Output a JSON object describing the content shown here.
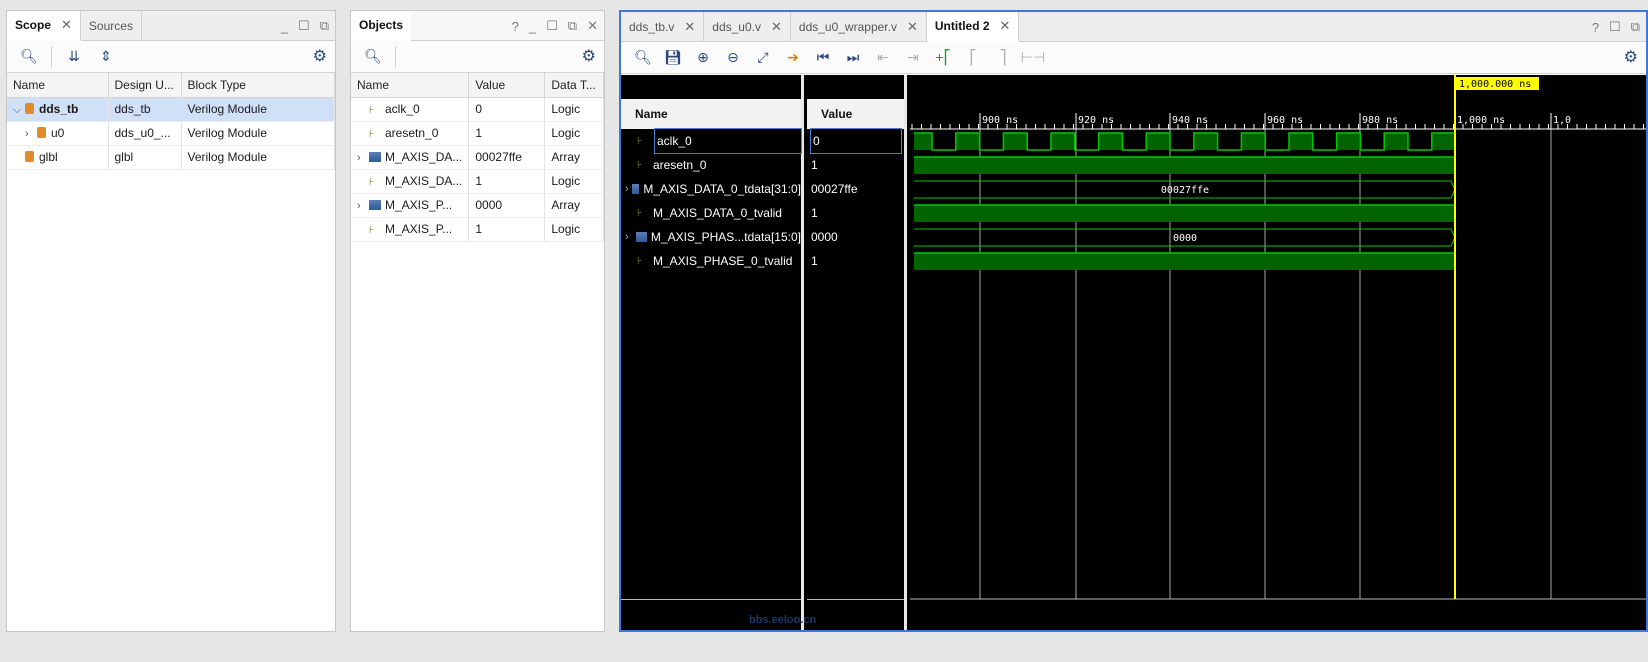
{
  "scope_panel": {
    "tabs": [
      {
        "label": "Scope"
      },
      {
        "label": "Sources"
      }
    ],
    "columns": [
      "Name",
      "Design U...",
      "Block Type"
    ],
    "rows": [
      {
        "name": "dds_tb",
        "design_unit": "dds_tb",
        "block_type": "Verilog Module",
        "expanded": true
      },
      {
        "name": "u0",
        "design_unit": "dds_u0_...",
        "block_type": "Verilog Module",
        "expanded": false
      },
      {
        "name": "glbl",
        "design_unit": "glbl",
        "block_type": "Verilog Module"
      }
    ]
  },
  "objects_panel": {
    "title": "Objects",
    "columns": [
      "Name",
      "Value",
      "Data T..."
    ],
    "rows": [
      {
        "name": "aclk_0",
        "value": "0",
        "type": "Logic"
      },
      {
        "name": "aresetn_0",
        "value": "1",
        "type": "Logic"
      },
      {
        "name": "M_AXIS_DA...",
        "value": "00027ffe",
        "type": "Array"
      },
      {
        "name": "M_AXIS_DA...",
        "value": "1",
        "type": "Logic"
      },
      {
        "name": "M_AXIS_P...",
        "value": "0000",
        "type": "Array"
      },
      {
        "name": "M_AXIS_P...",
        "value": "1",
        "type": "Logic"
      }
    ]
  },
  "wave_panel": {
    "tabs": [
      {
        "label": "dds_tb.v"
      },
      {
        "label": "dds_u0.v"
      },
      {
        "label": "dds_u0_wrapper.v"
      },
      {
        "label": "Untitled 2"
      }
    ],
    "name_header": "Name",
    "value_header": "Value",
    "signals": [
      {
        "name": "aclk_0",
        "value": "0",
        "kind": "clock"
      },
      {
        "name": "aresetn_0",
        "value": "1",
        "kind": "high"
      },
      {
        "name": "M_AXIS_DATA_0_tdata[31:0]",
        "value": "00027ffe",
        "kind": "bus",
        "bus_label": "00027ffe"
      },
      {
        "name": "M_AXIS_DATA_0_tvalid",
        "value": "1",
        "kind": "high"
      },
      {
        "name": "M_AXIS_PHAS...tdata[15:0]",
        "value": "0000",
        "kind": "bus",
        "bus_label": "0000"
      },
      {
        "name": "M_AXIS_PHASE_0_tvalid",
        "value": "1",
        "kind": "high"
      }
    ],
    "time_labels": [
      "900 ns",
      "920 ns",
      "940 ns",
      "960 ns",
      "980 ns",
      "1,000 ns",
      "1,0"
    ],
    "cursor_label": "1,000.000 ns",
    "watermark": "bbs.eeloo.cn",
    "colors": {
      "wave": "#00c800",
      "fill": "#006400",
      "cursor": "#ffff00",
      "grid": "#a8a8a8"
    }
  }
}
